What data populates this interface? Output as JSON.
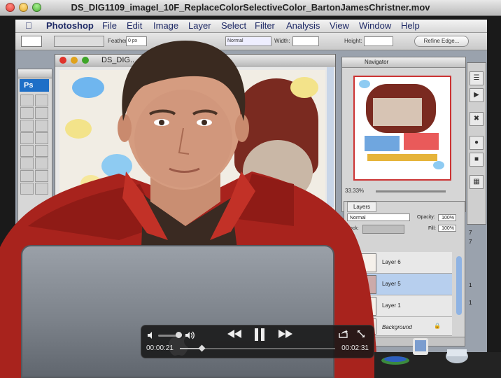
{
  "window": {
    "title": "DS_DIG1109_imageI_10F_ReplaceColorSelectiveColor_BartonJamesChristner.mov"
  },
  "photoshop": {
    "menu": [
      "Photoshop",
      "File",
      "Edit",
      "Image",
      "Layer",
      "Select",
      "Filter",
      "Analysis",
      "View",
      "Window",
      "Help"
    ],
    "options": {
      "feather_label": "Feather:",
      "feather_value": "0 px",
      "style_value": "Normal",
      "width_label": "Width:",
      "height_label": "Height:",
      "refine_label": "Refine Edge..."
    },
    "doc_title": "DS_DIG... ODEL_20091231_Fron",
    "logo": "Ps",
    "navigator": {
      "tab": "Navigator",
      "zoom": "33.33%"
    },
    "layers": {
      "tab": "Layers",
      "blend_mode": "Normal",
      "opacity_label": "Opacity:",
      "opacity_value": "100%",
      "lock_label": "Lock:",
      "fill_label": "Fill:",
      "fill_value": "100%",
      "items": [
        {
          "name": "Layer 6",
          "selected": false
        },
        {
          "name": "Layer 5",
          "selected": true
        },
        {
          "name": "Layer 1",
          "selected": false
        },
        {
          "name": "Background",
          "selected": false
        }
      ]
    },
    "side_text": [
      "7",
      "7",
      "1",
      "1"
    ]
  },
  "player": {
    "current_time": "00:00:21",
    "total_time": "00:02:31",
    "progress": 0.139,
    "volume": 0.85
  },
  "colors": {
    "hud_bg": "#181818",
    "shirt": "#a8231d",
    "layer_selected": "#b7cfee",
    "ps_logo": "#1e6fc7"
  }
}
